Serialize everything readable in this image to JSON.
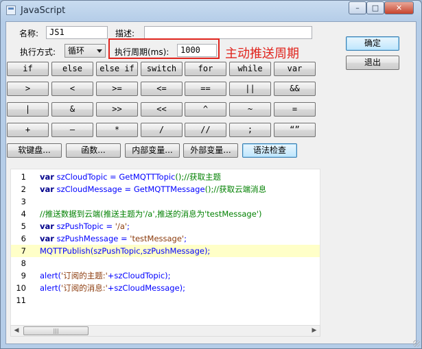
{
  "window": {
    "title": "JavaScript",
    "minimize": "–",
    "maximize": "□",
    "close": "✕"
  },
  "form": {
    "name_label": "名称:",
    "name_value": "JS1",
    "desc_label": "描述:",
    "desc_value": "",
    "mode_label": "执行方式:",
    "mode_value": "循环",
    "period_label": "执行周期(ms):",
    "period_value": "1000",
    "annotation": "主动推送周期"
  },
  "actions": {
    "ok": "确定",
    "exit": "退出"
  },
  "operators": [
    [
      "if",
      "else",
      "else if",
      "switch",
      "for",
      "while",
      "var"
    ],
    [
      ">",
      "<",
      ">=",
      "<=",
      "==",
      "||",
      "&&"
    ],
    [
      "|",
      "&",
      ">>",
      "<<",
      "^",
      "~",
      "="
    ],
    [
      "+",
      "—",
      "*",
      "/",
      "//",
      ";",
      "“”"
    ]
  ],
  "tools": {
    "keyboard": "软键盘...",
    "functions": "函数...",
    "internal_vars": "内部变量...",
    "external_vars": "外部变量...",
    "syntax_check": "语法检查"
  },
  "editor": {
    "line_numbers": [
      "1",
      "2",
      "3",
      "4",
      "5",
      "6",
      "7",
      "8",
      "9",
      "10",
      "11"
    ],
    "highlight_line": 7,
    "lines": [
      [
        {
          "t": "var",
          "c": "kw"
        },
        {
          "t": " szCloudTopic = ",
          "c": "fn"
        },
        {
          "t": "GetMQTTTopic",
          "c": "fn"
        },
        {
          "t": "();//获取主题",
          "c": "cm"
        }
      ],
      [
        {
          "t": "var",
          "c": "kw"
        },
        {
          "t": " szCloudMessage = ",
          "c": "fn"
        },
        {
          "t": "GetMQTTMessage",
          "c": "fn"
        },
        {
          "t": "();//获取云端消息",
          "c": "cm"
        }
      ],
      [],
      [
        {
          "t": "//推送数据到云端(推送主题为'/a',推送的消息为'testMessage')",
          "c": "cm"
        }
      ],
      [
        {
          "t": "var",
          "c": "kw"
        },
        {
          "t": " szPushTopic = ",
          "c": "fn"
        },
        {
          "t": "'/a'",
          "c": "st"
        },
        {
          "t": ";",
          "c": "fn"
        }
      ],
      [
        {
          "t": "var",
          "c": "kw"
        },
        {
          "t": " szPushMessage = ",
          "c": "fn"
        },
        {
          "t": "'testMessage'",
          "c": "st"
        },
        {
          "t": ";",
          "c": "fn"
        }
      ],
      [
        {
          "t": "MQTTPublish(szPushTopic,szPushMessage);",
          "c": "fn"
        }
      ],
      [],
      [
        {
          "t": "alert(",
          "c": "fn"
        },
        {
          "t": "'订阅的主题:'",
          "c": "st"
        },
        {
          "t": "+szCloudTopic);",
          "c": "fn"
        }
      ],
      [
        {
          "t": "alert(",
          "c": "fn"
        },
        {
          "t": "'订阅的消息:'",
          "c": "st"
        },
        {
          "t": "+szCloudMessage);",
          "c": "fn"
        }
      ],
      []
    ]
  },
  "scrollbar": {
    "left": "◀",
    "right": "▶"
  }
}
